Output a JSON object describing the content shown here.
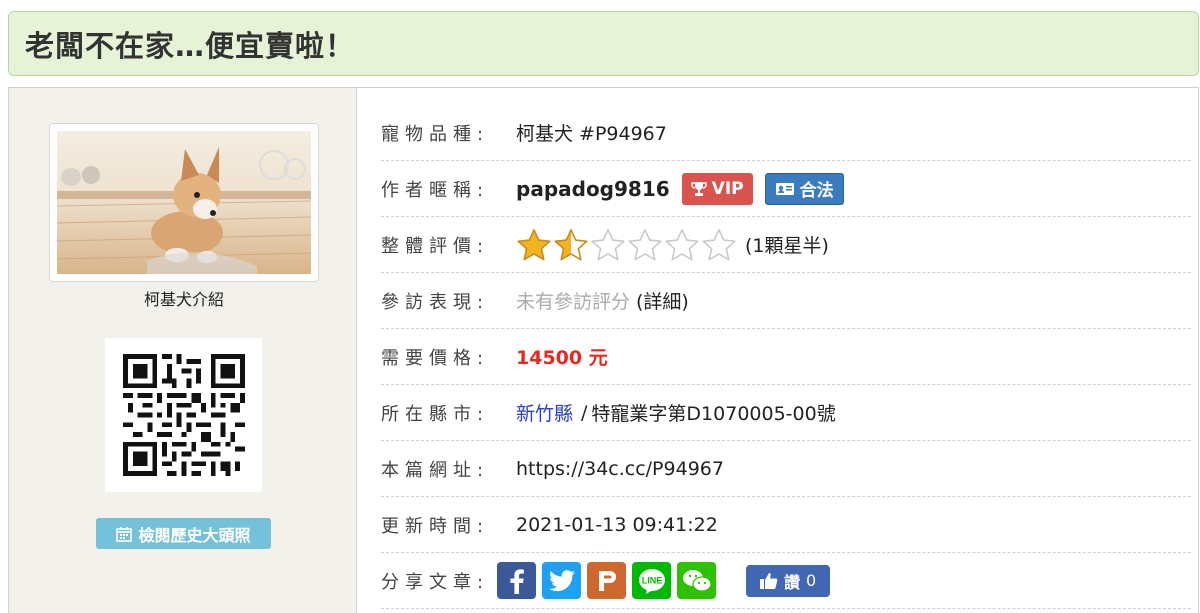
{
  "page": {
    "title": "老闆不在家…便宜賣啦！"
  },
  "left": {
    "caption": "柯基犬介紹",
    "history_button": "檢閱歷史大頭照"
  },
  "details": {
    "breed": {
      "label": "寵物品種:",
      "value": "柯基犬 #P94967"
    },
    "author": {
      "label": "作者暱稱:",
      "name": "papadog9816",
      "vip": "VIP",
      "legal": "合法"
    },
    "rating": {
      "label": "整體評價:",
      "stars": 1.5,
      "max_stars": 6,
      "text": "(1顆星半)"
    },
    "visit": {
      "label": "參訪表現:",
      "value": "未有參訪評分",
      "detail": "(詳細)"
    },
    "price": {
      "label": "需要價格:",
      "value": "14500 元"
    },
    "location": {
      "label": "所在縣市:",
      "city": "新竹縣",
      "separator": "/",
      "license": "特寵業字第D1070005-00號"
    },
    "url": {
      "label": "本篇網址:",
      "value": "https://34c.cc/P94967"
    },
    "updated": {
      "label": "更新時間:",
      "value": "2021-01-13 09:41:22"
    },
    "share": {
      "label": "分享文章:",
      "like_label": "讚",
      "like_count": "0",
      "line_text": "LINE"
    }
  },
  "colors": {
    "vip": "#d9534f",
    "legal": "#3b7cc1",
    "price": "#e8281e",
    "city": "#2a41c9",
    "facebook": "#3b5998",
    "twitter": "#1da1f2",
    "plurk": "#cf682f",
    "line": "#00b900",
    "wechat": "#2dc100"
  }
}
